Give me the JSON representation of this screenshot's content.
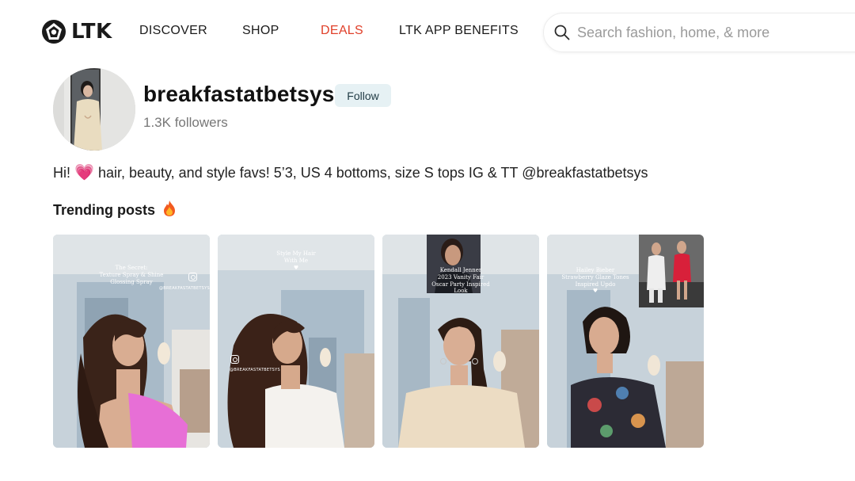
{
  "header": {
    "logo_text": "LTK",
    "nav": [
      {
        "label": "DISCOVER"
      },
      {
        "label": "SHOP"
      },
      {
        "label": "DEALS"
      },
      {
        "label": "LTK APP BENEFITS"
      }
    ],
    "search": {
      "placeholder": "Search fashion, home, & more",
      "icon": "search-icon"
    }
  },
  "profile": {
    "handle": "breakfastatbetsys",
    "follow_label": "Follow",
    "followers": "1.3K followers",
    "bio_prefix": "Hi!",
    "bio_emoji": "💗",
    "bio_text": "hair, beauty, and style favs! 5’3, US 4 bottoms, size S tops IG & TT @breakfastatbetsys"
  },
  "trending": {
    "title": "Trending posts",
    "emoji": "fire-icon"
  },
  "posts": [
    {
      "overlay_lines": [
        "The Secret:",
        "Texture Spray & Shine",
        "Glossing Spray"
      ],
      "tag": "@BREAKFASTATBETSYS"
    },
    {
      "overlay_lines": [
        "Style My Hair",
        "With Me"
      ],
      "overlay_heart": "♥",
      "tag": "@BREAKFASTATBETSYS"
    },
    {
      "overlay_lines": [
        "Kendall Jenner",
        "2023 Vanity Fair",
        "Oscar Party Inspired",
        "Look"
      ]
    },
    {
      "overlay_lines": [
        "Hailey Bieber",
        "Strawberry Glaze Tones",
        "Inspired Updo"
      ],
      "overlay_heart": "♥"
    }
  ],
  "colors": {
    "deals": "#e0402a",
    "follow_bg": "#e6f1f4",
    "heart": "#e94f9a"
  }
}
